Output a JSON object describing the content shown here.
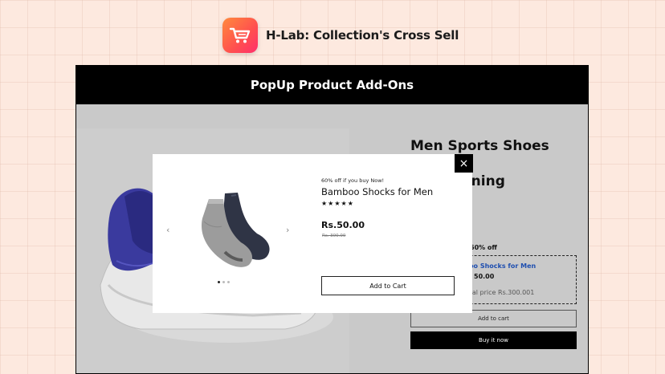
{
  "header": {
    "title": "H-Lab: Collection's Cross Sell"
  },
  "banner": {
    "title": "PopUp Product Add-Ons"
  },
  "product": {
    "title": "Men Sports Shoes with",
    "title_line2": "tening",
    "offer_label": "60% off",
    "offer_item": "mboo Shocks for Men",
    "offer_price": "50.00",
    "offer_original": "riginal price Rs.300.001",
    "add_to_cart": "Add to cart",
    "buy_now": "Buy it now"
  },
  "popup": {
    "offer_text": "60% off if you buy Now!",
    "name": "Bamboo Shocks for Men",
    "rating": "★★★★★",
    "price": "Rs.50.00",
    "compare_price": "Rs. 300.00",
    "add_to_cart": "Add to Cart",
    "close": "×",
    "prev": "‹",
    "next": "›"
  },
  "colors": {
    "accent_blue": "#1f4fb0",
    "logo_orange": "#ff8a3d",
    "logo_red": "#ff2f6d"
  },
  "icons": [
    "cart-icon",
    "close-icon",
    "chevron-left-icon",
    "chevron-right-icon",
    "star-icon"
  ]
}
